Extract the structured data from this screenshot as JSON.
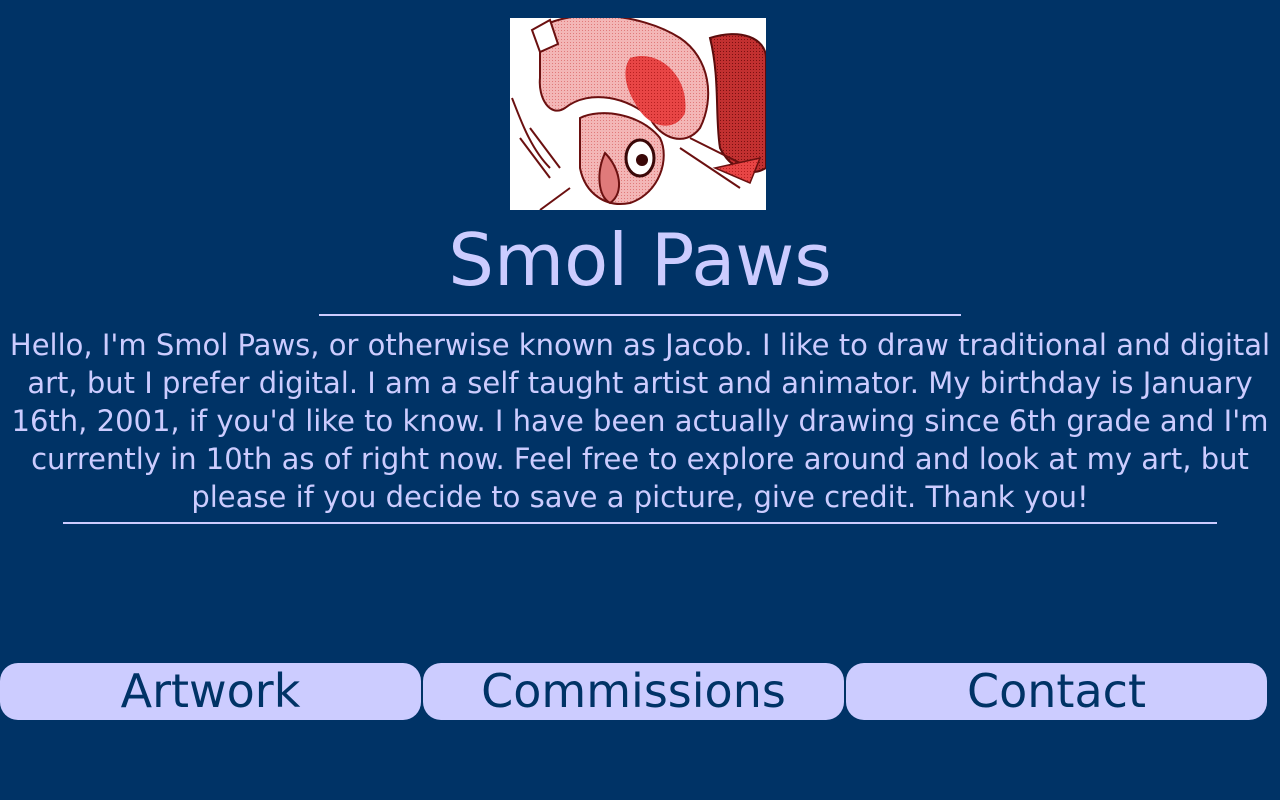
{
  "colors": {
    "background": "#003366",
    "text": "#ccccff",
    "button_bg": "#ccccff",
    "button_text": "#003366"
  },
  "header": {
    "avatar_icon": "avatar-artwork",
    "title": "Smol Paws"
  },
  "bio": {
    "text": "Hello, I'm Smol Paws, or otherwise known as Jacob. I like to draw traditional and digital art, but I prefer digital. I am a self taught artist and animator. My birthday is January 16th, 2001, if you'd like to know. I have been actually drawing since 6th grade and I'm currently in 10th as of right now. Feel free to explore around and look at my art, but please if you decide to save a picture, give credit. Thank you!"
  },
  "nav": {
    "items": [
      {
        "label": "Artwork"
      },
      {
        "label": "Commissions"
      },
      {
        "label": "Contact"
      }
    ]
  }
}
